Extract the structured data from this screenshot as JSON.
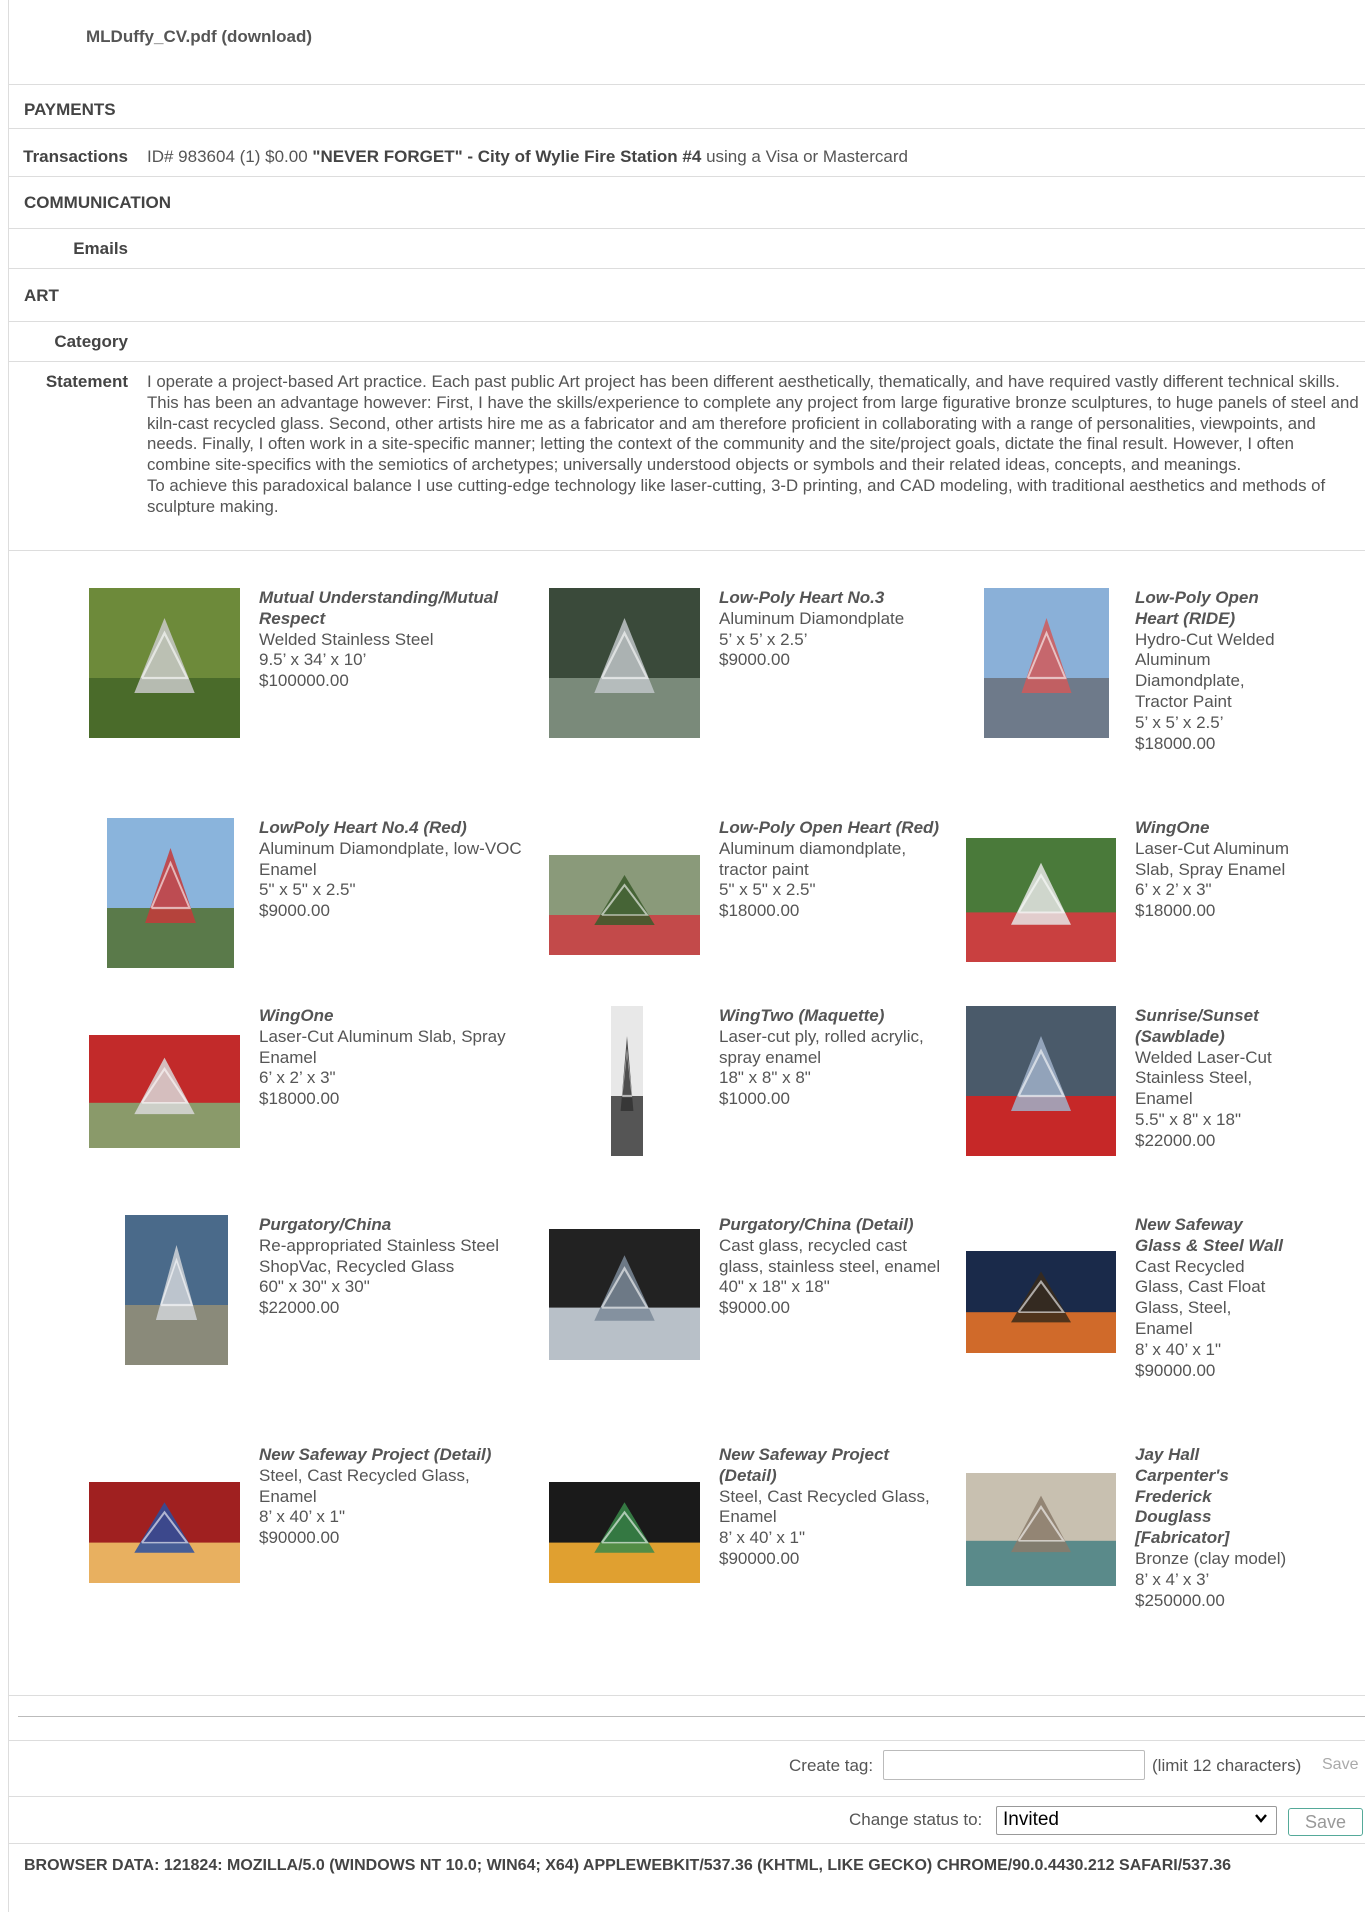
{
  "header": {
    "cv_link": "MLDuffy_CV.pdf (download)"
  },
  "payments": {
    "section_title": "PAYMENTS",
    "transactions_label": "Transactions",
    "transaction_prefix": "ID# 983604 (1) $0.00",
    "transaction_name": "\"NEVER FORGET\" - City of Wylie Fire Station #4",
    "transaction_suffix": "using a Visa or Mastercard"
  },
  "communication": {
    "section_title": "COMMUNICATION",
    "emails_label": "Emails"
  },
  "art": {
    "section_title": "ART",
    "category_label": "Category",
    "statement_label": "Statement",
    "statement_p1": "I operate a project-based Art practice. Each past public Art project has been different aesthetically, thematically, and have required vastly different technical skills. This has been an advantage however: First, I have the skills/experience to complete any project from large figurative bronze sculptures, to huge panels of steel and kiln-cast recycled glass. Second, other artists hire me as a fabricator and am therefore proficient in collaborating with a range of personalities, viewpoints, and needs. Finally, I often work in a site-specific manner; letting the context of the community and the site/project goals, dictate the final result. However, I often combine site-specifics with the semiotics of archetypes; universally understood objects or symbols and their related ideas, concepts, and meanings.",
    "statement_p2": "To achieve this paradoxical balance I use cutting-edge technology like laser-cutting, 3-D printing, and CAD modeling, with traditional aesthetics and methods of sculpture making."
  },
  "artworks": [
    {
      "title": "Mutual Understanding/Mutual Respect",
      "lines": [
        "Welded Stainless Steel",
        "9.5’ x 34’ x 10’",
        "$100000.00"
      ]
    },
    {
      "title": "Low-Poly Heart No.3",
      "lines": [
        "Aluminum Diamondplate",
        "5’ x 5’ x 2.5’",
        "$9000.00"
      ]
    },
    {
      "title": "Low-Poly Open Heart (RIDE)",
      "lines": [
        "Hydro-Cut Welded Aluminum Diamondplate, Tractor Paint",
        "5’ x 5’ x 2.5’",
        "$18000.00"
      ]
    },
    {
      "title": "LowPoly Heart No.4 (Red)",
      "lines": [
        "Aluminum Diamondplate, low-VOC Enamel",
        "5\" x 5\" x 2.5\"",
        "$9000.00"
      ]
    },
    {
      "title": "Low-Poly Open Heart (Red)",
      "lines": [
        "Aluminum diamondplate, tractor paint",
        "5\" x 5\" x 2.5\"",
        "$18000.00"
      ]
    },
    {
      "title": "WingOne",
      "lines": [
        "Laser-Cut Aluminum Slab, Spray Enamel",
        "6’ x 2’ x 3\"",
        "$18000.00"
      ]
    },
    {
      "title": "WingOne",
      "lines": [
        "Laser-Cut Aluminum Slab, Spray Enamel",
        "6’ x 2’ x 3\"",
        "$18000.00"
      ]
    },
    {
      "title": "WingTwo (Maquette)",
      "lines": [
        "Laser-cut ply, rolled acrylic, spray enamel",
        "18\" x 8\" x 8\"",
        "$1000.00"
      ]
    },
    {
      "title": "Sunrise/Sunset (Sawblade)",
      "lines": [
        "Welded Laser-Cut Stainless Steel, Enamel",
        "5.5\" x 8\" x 18\"",
        "$22000.00"
      ]
    },
    {
      "title": "Purgatory/China",
      "lines": [
        "Re-appropriated Stainless Steel ShopVac, Recycled Glass",
        "60\" x 30\" x 30\"",
        "$22000.00"
      ]
    },
    {
      "title": "Purgatory/China (Detail)",
      "lines": [
        "Cast glass, recycled cast glass, stainless steel, enamel",
        "40\" x 18\" x 18\"",
        "$9000.00"
      ]
    },
    {
      "title": "New Safeway Glass & Steel Wall",
      "lines": [
        "Cast Recycled Glass, Cast Float Glass, Steel, Enamel",
        "8’ x 40’ x 1\"",
        "$90000.00"
      ]
    },
    {
      "title": "New Safeway Project (Detail)",
      "lines": [
        "Steel, Cast Recycled Glass, Enamel",
        "8’ x 40’ x 1\"",
        "$90000.00"
      ]
    },
    {
      "title": "New Safeway Project (Detail)",
      "lines": [
        "Steel, Cast Recycled Glass, Enamel",
        "8’ x 40’ x 1\"",
        "$90000.00"
      ]
    },
    {
      "title": "Jay Hall Carpenter's Frederick Douglass [Fabricator]",
      "lines": [
        "Bronze (clay model)",
        "8’ x 4’ x 3’",
        "$250000.00"
      ]
    }
  ],
  "tag": {
    "label": "Create tag:",
    "value": "",
    "limit": "(limit 12 characters)",
    "save": "Save"
  },
  "status": {
    "label": "Change status to:",
    "selected": "Invited",
    "save": "Save"
  },
  "browser": {
    "text": "BROWSER DATA: 121824: MOZILLA/5.0 (WINDOWS NT 10.0; WIN64; X64) APPLEWEBKIT/537.36 (KHTML, LIKE GECKO) CHROME/90.0.4430.212 SAFARI/537.36"
  }
}
